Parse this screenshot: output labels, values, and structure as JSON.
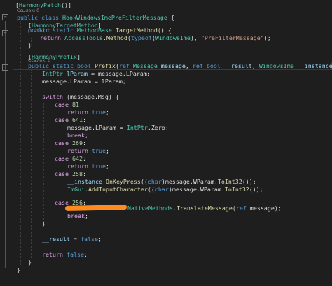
{
  "refs_0": "Ссылок: 0",
  "colors": {
    "background": "#1e1e1e",
    "keyword": "#569cd6",
    "control_keyword": "#d8a0df",
    "type": "#4ec9b0",
    "string": "#d69d85",
    "number": "#b5cea8",
    "method": "#dcdcaa",
    "variable": "#9cdcfe",
    "plain": "#dcdcdc",
    "redaction": "#ff8a1e"
  },
  "code": {
    "l01": {
      "p1": "[",
      "p2": "HarmonyPatch",
      "p3": "()]"
    },
    "l03": {
      "k1": "public",
      "k2": "class",
      "t1": "HookWindowsImePreFilterMessage",
      "p1": " {"
    },
    "l05": {
      "p0": "[",
      "t1": "HarmonyTargetMethod",
      "p1": "]"
    },
    "l06": {
      "k1": "public",
      "k2": "static",
      "t1": "MethodBase",
      "m1": "TargetMethod",
      "p1": "() {"
    },
    "l07": {
      "c1": "return",
      "t1": "AccessTools",
      "p1": ".",
      "m1": "Method",
      "p2": "(",
      "k1": "typeof",
      "p3": "(",
      "t2": "WindowsIme",
      "p4": "), ",
      "s1": "\"PreFilterMessage\"",
      "p5": ");"
    },
    "l08": {
      "p1": "}"
    },
    "l10": {
      "p0": "[",
      "t1": "HarmonyPrefix",
      "p1": "]"
    },
    "l11": {
      "k1": "public",
      "k2": "static",
      "k3": "bool",
      "m1": "Prefix",
      "p1": "(",
      "k4": "ref",
      "t1": "Message",
      "v1": "message",
      "p2": ", ",
      "k5": "ref",
      "k6": "bool",
      "v2": "__result",
      "p3": ", ",
      "t2": "WindowsIme",
      "v3": "__instance",
      "p4": ") {"
    },
    "l12": {
      "t1": "IntPtr",
      "v1": "lParam",
      "p1": " = message.LParam;"
    },
    "l13": {
      "p1": "message.LParam = lParam;"
    },
    "l15": {
      "c1": "switch",
      "p1": " (message.Msg) {"
    },
    "l16": {
      "c1": "case",
      "n1": "81",
      "p1": ":"
    },
    "l17": {
      "c1": "return",
      "k1": "true",
      "p1": ";"
    },
    "l18": {
      "c1": "case",
      "n1": "641",
      "p1": ":"
    },
    "l19": {
      "p1": "message.LParam = ",
      "t1": "IntPtr",
      "p2": ".Zero;"
    },
    "l20": {
      "c1": "break",
      "p1": ";"
    },
    "l21": {
      "c1": "case",
      "n1": "269",
      "p1": ":"
    },
    "l22": {
      "c1": "return",
      "k1": "true",
      "p1": ";"
    },
    "l23": {
      "c1": "case",
      "n1": "642",
      "p1": ":"
    },
    "l24": {
      "c1": "return",
      "k1": "true",
      "p1": ";"
    },
    "l25": {
      "c1": "case",
      "n1": "258",
      "p1": ":"
    },
    "l26": {
      "v1": "__instance",
      "p1": ".",
      "m1": "OnKeyPress",
      "p2": "((",
      "k1": "char",
      "p3": ")message.WParam.",
      "m2": "ToInt32",
      "p4": "());"
    },
    "l27": {
      "t1": "ImGui",
      "p1": ".",
      "m1": "AddInputCharacter",
      "p2": "((",
      "k1": "char",
      "p3": ")message.WParam.",
      "m2": "ToInt32",
      "p4": "());"
    },
    "l28": {
      "c1": "case",
      "n1": "256",
      "p1": ":"
    },
    "l29": {
      "t1": "NativeMethods",
      "p1": ".",
      "m1": "TranslateMessage",
      "p2": "(",
      "k1": "ref",
      "p3": " message);"
    },
    "l30": {
      "c1": "break",
      "p1": ";"
    },
    "l31": {
      "p1": "}"
    },
    "l33": {
      "v1": "__result",
      "p1": " = ",
      "k1": "false",
      "p2": ";"
    },
    "l35": {
      "c1": "return",
      "k1": "false",
      "p1": ";"
    },
    "l36": {
      "p1": "}"
    },
    "l37": {
      "p1": "}"
    }
  }
}
